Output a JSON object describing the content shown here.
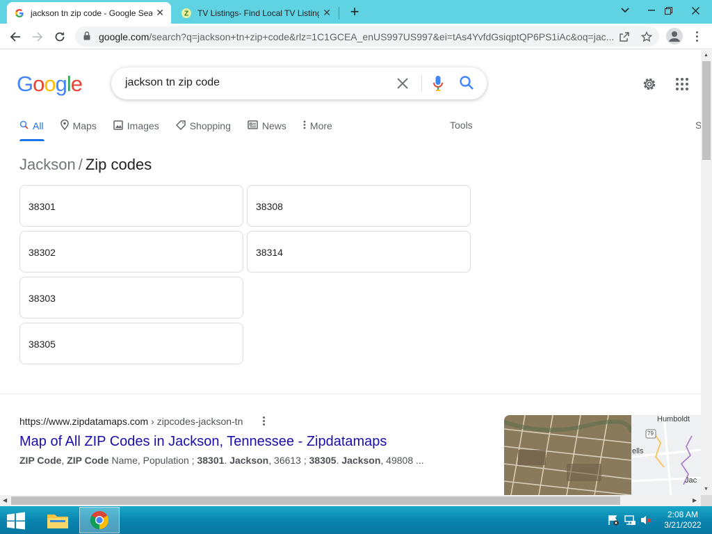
{
  "browser": {
    "tabs": [
      {
        "title": "jackson tn zip code - Google Sea",
        "favicon": "google-g-icon",
        "active": true
      },
      {
        "title": "TV Listings- Find Local TV Listing",
        "favicon": "tvl-z-icon",
        "active": false
      }
    ],
    "address": {
      "host": "google.com",
      "rest": "/search?q=jackson+tn+zip+code&rlz=1C1GCEA_enUS997US997&ei=tAs4YvfdGsiqptQP6PS1iAc&oq=jac..."
    }
  },
  "google": {
    "logo": [
      "G",
      "o",
      "o",
      "g",
      "l",
      "e"
    ],
    "query": "jackson tn zip code",
    "nav_tabs": [
      {
        "label": "All",
        "icon": "search-icon"
      },
      {
        "label": "Maps",
        "icon": "map-pin-icon"
      },
      {
        "label": "Images",
        "icon": "image-icon"
      },
      {
        "label": "Shopping",
        "icon": "tag-icon"
      },
      {
        "label": "News",
        "icon": "news-icon"
      },
      {
        "label": "More",
        "icon": "more-vert-icon"
      }
    ],
    "tools_label": "Tools",
    "edge_text": "S",
    "breadcrumb": {
      "parent": "Jackson",
      "sep": "/",
      "current": "Zip codes"
    },
    "zip_codes": [
      "38301",
      "38308",
      "38302",
      "38314",
      "38303",
      "38305"
    ],
    "result": {
      "url": "https://www.zipdatamaps.com",
      "path": " › zipcodes-jackson-tn",
      "title": "Map of All ZIP Codes in Jackson, Tennessee - Zipdatamaps",
      "snippet": {
        "b1": "ZIP Code",
        "t1": ", ",
        "b2": "ZIP Code",
        "t2": " Name, Population ; ",
        "b3": "38301",
        "t3": ". ",
        "b4": "Jackson",
        "t4": ", 36613 ; ",
        "b5": "38305",
        "t5": ". ",
        "b6": "Jackson",
        "t6": ", 49808 ..."
      },
      "map_labels": {
        "city1": "Humboldt",
        "route": "79",
        "city2": "ells",
        "city3": "Jac"
      }
    }
  },
  "taskbar": {
    "time": "2:08 AM",
    "date": "3/21/2022"
  },
  "colors": {
    "tabstrip": "#5fd3e2",
    "link": "#1a0dab",
    "accent": "#1a73e8"
  }
}
